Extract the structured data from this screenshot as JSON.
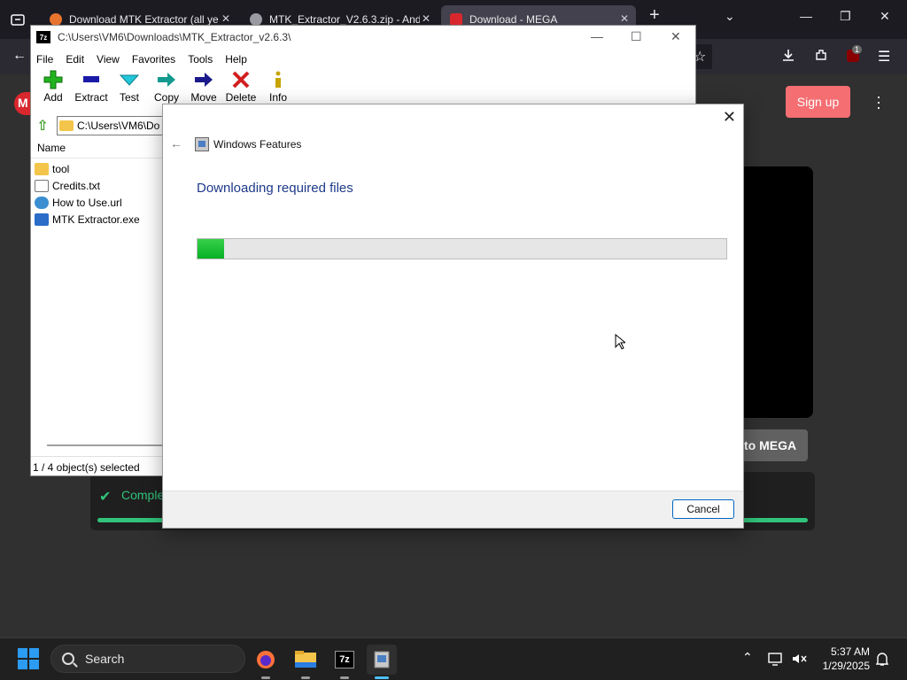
{
  "browser": {
    "tabs": [
      {
        "label": "Download MTK Extractor (all ye",
        "active": false
      },
      {
        "label": "MTK_Extractor_V2.6.3.zip - And",
        "active": false
      },
      {
        "label": "Download - MEGA",
        "active": true
      }
    ],
    "new_tab_symbol": "+",
    "extensions_badge": "1"
  },
  "mega": {
    "signup_label": "Sign up",
    "button_partial_label": "to MEGA",
    "complete_partial_label": "Comple",
    "logo_letter": "M"
  },
  "sevenzip": {
    "app_icon_label": "7z",
    "title": "C:\\Users\\VM6\\Downloads\\MTK_Extractor_v2.6.3\\",
    "menu": [
      "File",
      "Edit",
      "View",
      "Favorites",
      "Tools",
      "Help"
    ],
    "toolbar": [
      {
        "label": "Add",
        "icon": "plus-icon",
        "color": "#22b21f"
      },
      {
        "label": "Extract",
        "icon": "minus-icon",
        "color": "#1a1aa6"
      },
      {
        "label": "Test",
        "icon": "check-icon",
        "color": "#22a8c8"
      },
      {
        "label": "Copy",
        "icon": "copy-arrow-icon",
        "color": "#149a8f"
      },
      {
        "label": "Move",
        "icon": "move-arrow-icon",
        "color": "#1a1a8a"
      },
      {
        "label": "Delete",
        "icon": "delete-x-icon",
        "color": "#d21f1f"
      },
      {
        "label": "Info",
        "icon": "info-icon",
        "color": "#c8a400"
      }
    ],
    "path_partial": "C:\\Users\\VM6\\Do",
    "column_name": "Name",
    "files": [
      {
        "name": "tool",
        "kind": "folder"
      },
      {
        "name": "Credits.txt",
        "kind": "txt"
      },
      {
        "name": "How to Use.url",
        "kind": "url"
      },
      {
        "name": "MTK Extractor.exe",
        "kind": "exe"
      }
    ],
    "status": "1 / 4 object(s) selected"
  },
  "dialog": {
    "title": "Windows Features",
    "heading": "Downloading required files",
    "progress_fraction": 0.05,
    "cancel_label": "Cancel"
  },
  "taskbar": {
    "search_label": "Search",
    "apps": [
      {
        "name": "firefox-icon",
        "active": false
      },
      {
        "name": "file-explorer-icon",
        "active": false
      },
      {
        "name": "sevenzip-icon",
        "active": false
      },
      {
        "name": "windows-features-icon",
        "active": true
      }
    ],
    "time": "5:37 AM",
    "date": "1/29/2025"
  },
  "colors": {
    "accent": "#0067c0",
    "heading_blue": "#1e3a8a",
    "progress_green": "#06b025",
    "mega_red": "#d9272e",
    "mega_green": "#32c37b"
  }
}
